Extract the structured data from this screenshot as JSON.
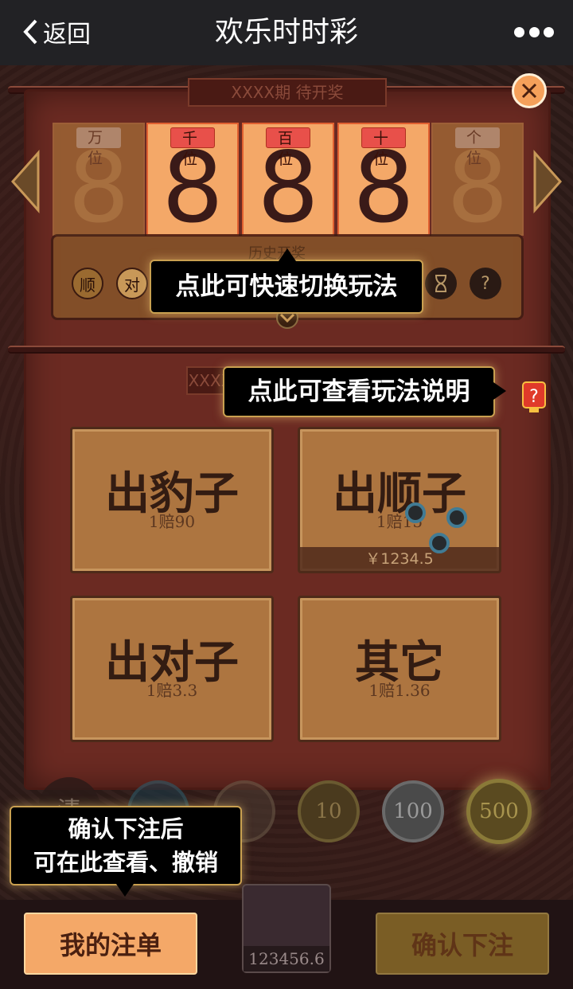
{
  "topbar": {
    "back_label": "返回",
    "title": "欢乐时时彩"
  },
  "draw": {
    "period_label": "XXXX期 待开奖",
    "digits": [
      {
        "label": "万位",
        "value": "8",
        "state": "dim"
      },
      {
        "label": "千位",
        "value": "8",
        "state": "lit"
      },
      {
        "label": "百位",
        "value": "8",
        "state": "lit"
      },
      {
        "label": "十位",
        "value": "8",
        "state": "lit"
      },
      {
        "label": "个位",
        "value": "8",
        "state": "dim"
      }
    ]
  },
  "history": {
    "label": "历史开奖",
    "buttons": [
      "顺",
      "对"
    ],
    "help_icon": "?"
  },
  "tooltips": {
    "switch_mode": "点此可快速切换玩法",
    "rules": "点此可查看玩法说明",
    "orders_line1": "确认下注后",
    "orders_line2": "可在此查看、撤销"
  },
  "section_plaque": "XXXX",
  "bets": [
    {
      "name": "出豹子",
      "odds": "1赔90"
    },
    {
      "name": "出顺子",
      "odds": "1赔15",
      "amount": "￥1234.5"
    },
    {
      "name": "出对子",
      "odds": "1赔3.3"
    },
    {
      "name": "其它",
      "odds": "1赔1.36"
    }
  ],
  "chips": {
    "clear": "清",
    "values": [
      "10",
      "100",
      "500"
    ]
  },
  "bottom": {
    "my_orders": "我的注单",
    "balance": "123456.6",
    "confirm": "确认下注"
  },
  "colors": {
    "lit_card": "#f4a868",
    "panel": "#6b2a22",
    "tooltip_border": "#c9a050"
  }
}
